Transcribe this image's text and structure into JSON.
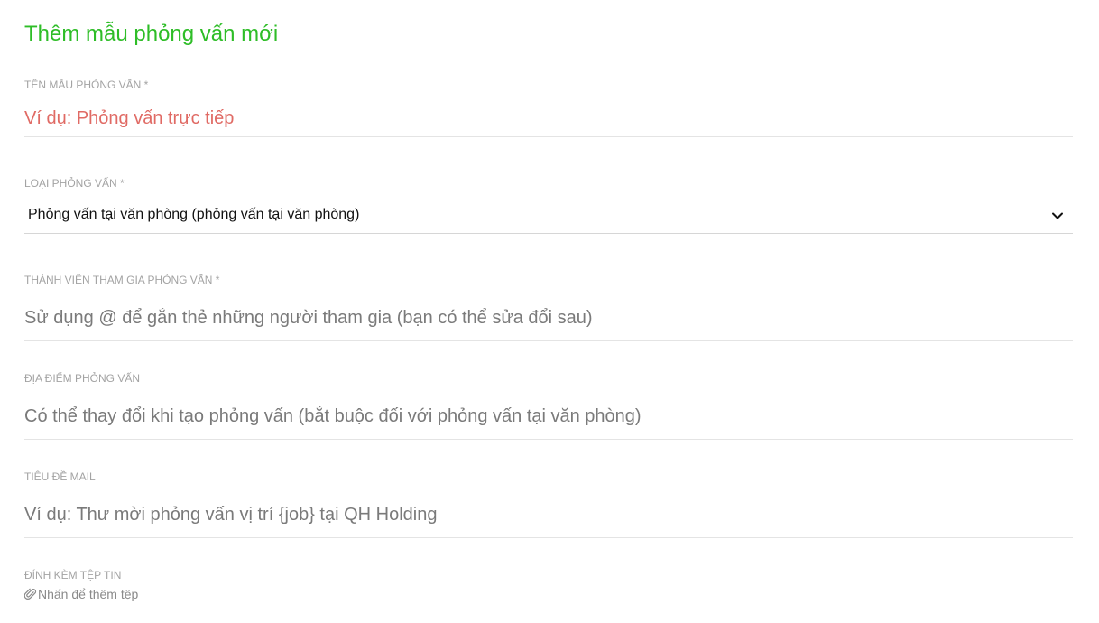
{
  "form": {
    "title": "Thêm mẫu phỏng vấn mới",
    "template_name": {
      "label": "TÊN MẪU PHỎNG VẤN *",
      "placeholder": "Ví dụ: Phỏng vấn trực tiếp",
      "value": ""
    },
    "interview_type": {
      "label": "LOẠI PHỎNG VẤN *",
      "selected": "Phỏng vấn tại văn phòng (phỏng vấn tại văn phòng)"
    },
    "participants": {
      "label": "THÀNH VIÊN THAM GIA PHỎNG VẤN *",
      "placeholder": "Sử dụng @ để gắn thẻ những người tham gia (bạn có thể sửa đổi sau)",
      "value": ""
    },
    "location": {
      "label": "ĐỊA ĐIỂM PHỎNG VẤN",
      "placeholder": "Có thể thay đổi khi tạo phỏng vấn (bắt buộc đối với phỏng vấn tại văn phòng)",
      "value": ""
    },
    "mail_subject": {
      "label": "TIÊU ĐỀ MAIL",
      "placeholder": "Ví dụ: Thư mời phỏng vấn vị trí {job} tại QH Holding",
      "value": ""
    },
    "attachment": {
      "label": "ĐÍNH KÈM TỆP TIN",
      "link": "Nhấn để thêm tệp",
      "icon": "paperclip-icon"
    }
  },
  "colors": {
    "title": "#2ebd27",
    "error_placeholder": "#e06a64",
    "label": "#a3a3a3",
    "placeholder": "#7a7a7a"
  }
}
